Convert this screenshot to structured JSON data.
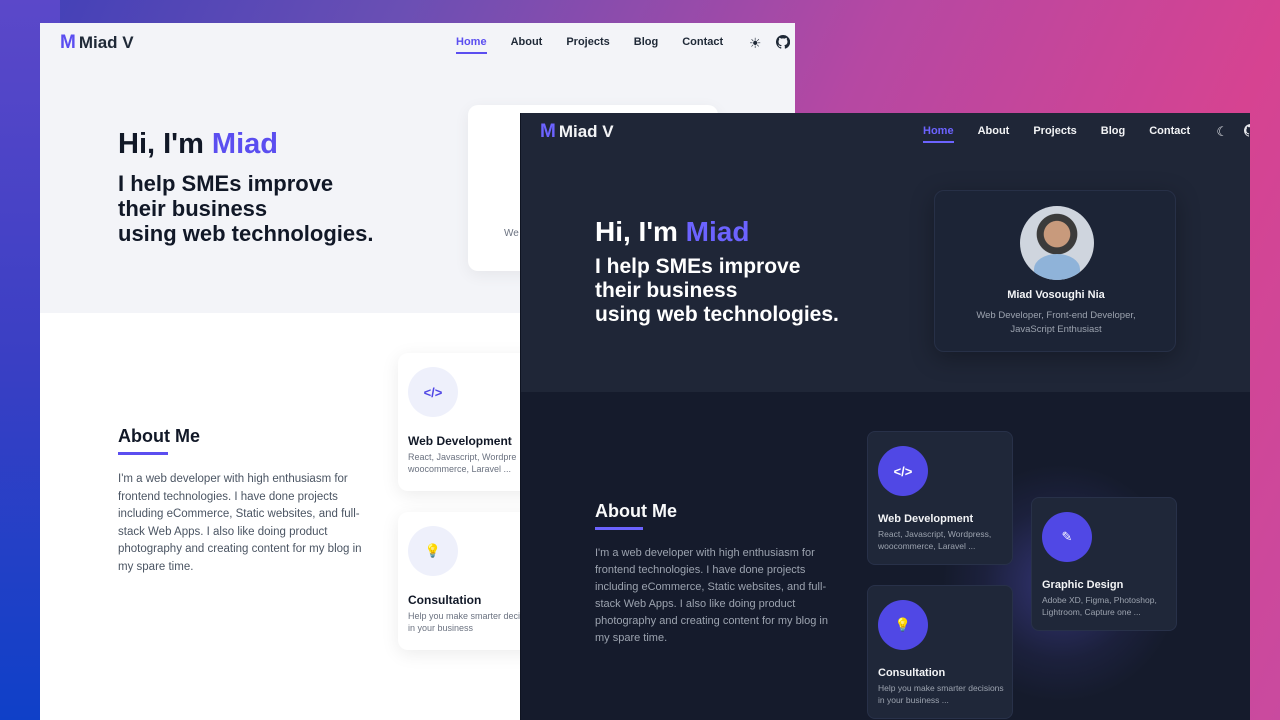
{
  "brand": {
    "logo_mark": "M",
    "name": "Miad V",
    "accent": "#5b4ef0"
  },
  "nav": {
    "items": [
      "Home",
      "About",
      "Projects",
      "Blog",
      "Contact"
    ],
    "active": "Home"
  },
  "icons": {
    "light_theme": "sun-icon",
    "dark_theme": "moon-icon",
    "github": "github-icon"
  },
  "hero": {
    "greeting": "Hi, I'm ",
    "name": "Miad",
    "tagline_1": "I help SMEs improve",
    "tagline_2": "their business",
    "tagline_3": "using web technologies."
  },
  "profile": {
    "name": "Miad Vosoughi Nia",
    "role_1": "Web Developer, Front-end Developer,",
    "role_2": "JavaScript Enthusiast",
    "light_fragment": "We"
  },
  "about": {
    "title": "About Me",
    "text": "I'm a web developer with high enthusiasm for frontend technologies. I have done projects including eCommerce, Static websites, and full-stack Web Apps. I also like doing product photography and creating content for my blog in my spare time."
  },
  "services": {
    "web": {
      "icon": "code-window-icon",
      "glyph": "</>",
      "title": "Web Development",
      "light_desc": "React, Javascript, Wordpre woocommerce, Laravel ...",
      "dark_desc": "React, Javascript, Wordpress, woocommerce, Laravel ..."
    },
    "consult": {
      "icon": "lightbulb-icon",
      "glyph": "💡",
      "title": "Consultation",
      "light_desc": "Help you make smarter decisions in your business",
      "dark_desc": "Help you make smarter decisions in your business ..."
    },
    "graphic": {
      "icon": "design-tools-icon",
      "glyph": "✎",
      "title": "Graphic Design",
      "dark_desc": "Adobe XD, Figma, Photoshop, Lightroom, Capture one ..."
    }
  }
}
